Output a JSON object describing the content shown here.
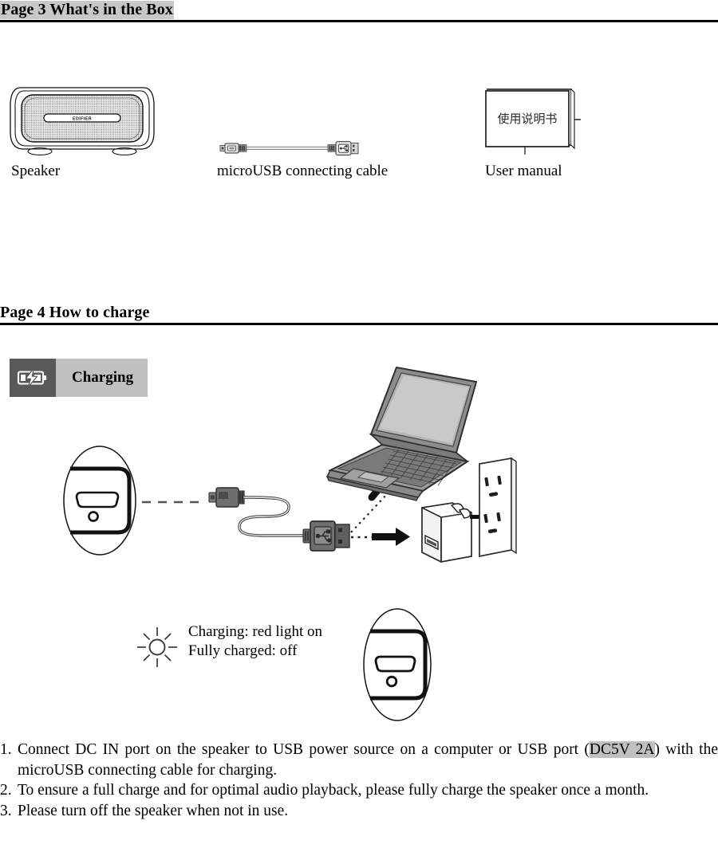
{
  "page3": {
    "heading": "Page 3 What's in the Box",
    "items": [
      {
        "caption": "Speaker",
        "icon": "speaker-icon",
        "brand": "EDIFIER"
      },
      {
        "caption": "microUSB connecting cable",
        "icon": "usb-cable-icon"
      },
      {
        "caption": "User manual",
        "icon": "user-manual-icon",
        "cover_text": "使用说明书"
      }
    ]
  },
  "page4": {
    "heading": "Page 4 How to charge",
    "badge": {
      "icon": "battery-charging-icon",
      "label": "Charging"
    },
    "diagram": {
      "speaker_port_icon": "speaker-dcin-port-icon",
      "cable_icon": "usb-cable-icon",
      "laptop_icon": "laptop-icon",
      "adapter_icon": "usb-power-adapter-icon",
      "outlet_icon": "wall-outlet-icon"
    },
    "led_legend": {
      "icon": "indicator-light-icon",
      "line1": "Charging: red light on",
      "line2": "Fully charged: off",
      "port_icon": "speaker-dcin-port-icon"
    },
    "instructions": [
      {
        "num": "1.",
        "pre": "Connect DC IN port on the speaker to USB power source on a computer or USB port (",
        "highlight": "DC5V 2A",
        "post": ") with the microUSB connecting cable for charging."
      },
      {
        "num": "2.",
        "pre": "To ensure a full charge and for optimal audio playback, please fully charge the speaker once a month.",
        "highlight": "",
        "post": ""
      },
      {
        "num": "3.",
        "pre": "Please turn off the speaker when not in use.",
        "highlight": "",
        "post": ""
      }
    ]
  },
  "colors": {
    "highlight_gray": "#c0c0c0",
    "badge_icon_bg": "#595959",
    "rule_black": "#000000",
    "device_gray": "#6e6e6e"
  }
}
